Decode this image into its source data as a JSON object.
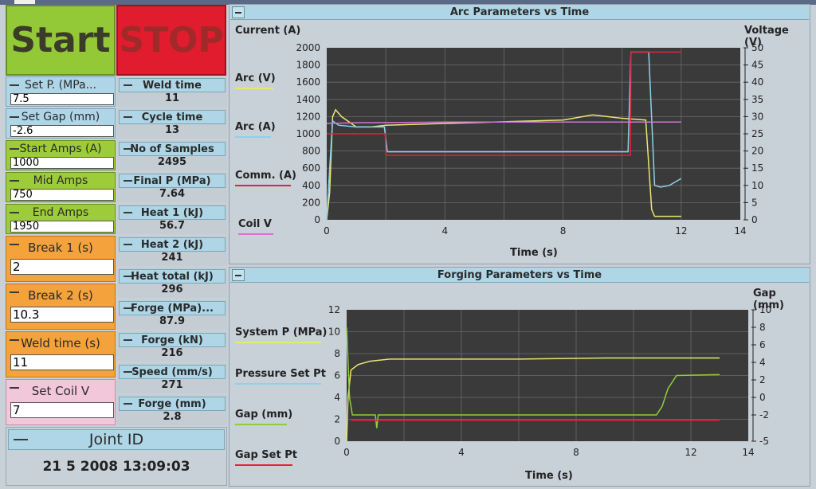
{
  "buttons": {
    "start_label": "Start",
    "stop_label": "STOP"
  },
  "controls": [
    {
      "label": "Set P. (MPa...",
      "value": "7.5",
      "color": "blue"
    },
    {
      "label": "Set Gap (mm)",
      "value": "-2.6",
      "color": "blue"
    },
    {
      "label": "Start Amps (A)",
      "value": "1000",
      "color": "green"
    },
    {
      "label": "Mid Amps",
      "value": "750",
      "color": "green"
    },
    {
      "label": "End Amps",
      "value": "1950",
      "color": "green"
    },
    {
      "label": "Break 1 (s)",
      "value": "2",
      "color": "orange"
    },
    {
      "label": "Break 2 (s)",
      "value": "10.3",
      "color": "orange"
    },
    {
      "label": "Weld time (s)",
      "value": "11",
      "color": "orange"
    },
    {
      "label": "Set Coil V",
      "value": "7",
      "color": "pink"
    }
  ],
  "indicators": [
    {
      "label": "Weld time",
      "value": "11"
    },
    {
      "label": "Cycle time",
      "value": "13"
    },
    {
      "label": "No of Samples",
      "value": "2495"
    },
    {
      "label": "Final P (MPa)",
      "value": "7.64"
    },
    {
      "label": "Heat 1 (kJ)",
      "value": "56.7"
    },
    {
      "label": "Heat 2 (kJ)",
      "value": "241"
    },
    {
      "label": "Heat total (kJ)",
      "value": "296"
    },
    {
      "label": "Forge (MPa)...",
      "value": "87.9"
    },
    {
      "label": "Forge (kN)",
      "value": "216"
    },
    {
      "label": "Speed (mm/s)",
      "value": "271"
    },
    {
      "label": "Forge (mm)",
      "value": "2.8"
    }
  ],
  "joint": {
    "title": "Joint ID",
    "timestamp": "21  5  2008  13:09:03"
  },
  "chart_data": [
    {
      "type": "line",
      "title": "Arc Parameters vs Time",
      "xlabel": "Time (s)",
      "ylabel": "Current (A)",
      "y2label": "Voltage (V)",
      "xlim": [
        0,
        14
      ],
      "ylim": [
        0,
        2000
      ],
      "y2lim": [
        0,
        50
      ],
      "xticks": [
        "0",
        "4",
        "8",
        "12",
        "14"
      ],
      "yticks": [
        "0",
        "200",
        "400",
        "600",
        "800",
        "1000",
        "1200",
        "1400",
        "1600",
        "1800",
        "2000"
      ],
      "y2ticks": [
        "0",
        "5",
        "10",
        "15",
        "20",
        "25",
        "30",
        "35",
        "40",
        "45",
        "50"
      ],
      "series": [
        {
          "name": "Arc (V)",
          "axis": "right",
          "color": "#e8e870",
          "x": [
            0,
            0.1,
            0.2,
            0.3,
            0.5,
            1.0,
            1.5,
            2.0,
            4.0,
            6.0,
            8.0,
            9.0,
            10.0,
            10.8,
            11.0,
            11.1,
            12.0
          ],
          "y": [
            0,
            8,
            30,
            32,
            30,
            27,
            27,
            27.5,
            28,
            28.5,
            29,
            30.5,
            29.5,
            29,
            3,
            1,
            1
          ]
        },
        {
          "name": "Arc (A)",
          "axis": "left",
          "color": "#8fd0e8",
          "x": [
            0,
            0.1,
            0.2,
            0.4,
            1.0,
            1.5,
            1.95,
            2.05,
            4.0,
            6.0,
            8.0,
            10.2,
            10.3,
            10.6,
            10.9,
            11.1,
            11.3,
            11.6,
            12.0
          ],
          "y": [
            0,
            600,
            1150,
            1100,
            1080,
            1080,
            1080,
            790,
            790,
            790,
            790,
            790,
            1950,
            1950,
            1950,
            400,
            380,
            400,
            480
          ]
        },
        {
          "name": "Comm. (A)",
          "axis": "left",
          "color": "#e8203a",
          "x": [
            0,
            0.3,
            1.98,
            2.0,
            10.28,
            10.3,
            12.0
          ],
          "y": [
            1000,
            1000,
            1000,
            750,
            750,
            1950,
            1950
          ]
        },
        {
          "name": "Coil V",
          "axis": "right",
          "color": "#d870d8",
          "x": [
            0,
            1,
            4,
            8,
            10,
            12
          ],
          "y": [
            28,
            28.2,
            28.4,
            28.4,
            28.4,
            28.4
          ]
        }
      ]
    },
    {
      "type": "line",
      "title": "Forging Parameters vs Time",
      "xlabel": "Time (s)",
      "ylabel": "",
      "y2label": "Gap (mm)",
      "xlim": [
        0,
        14
      ],
      "ylim": [
        0,
        12
      ],
      "y2lim": [
        -5,
        10
      ],
      "xticks": [
        "0",
        "4",
        "8",
        "12",
        "14"
      ],
      "yticks": [
        "0",
        "2",
        "4",
        "6",
        "8",
        "10",
        "12"
      ],
      "y2ticks": [
        "-5",
        "-2",
        "0",
        "2",
        "4",
        "6",
        "8",
        "10"
      ],
      "series": [
        {
          "name": "System P (MPa)",
          "axis": "left",
          "color": "#e8e870",
          "x": [
            0,
            0.05,
            0.15,
            0.4,
            0.8,
            1.5,
            3.0,
            6.0,
            9.0,
            11.0,
            13.0
          ],
          "y": [
            0,
            4,
            6.5,
            7.0,
            7.3,
            7.5,
            7.5,
            7.5,
            7.6,
            7.6,
            7.6
          ]
        },
        {
          "name": "Pressure Set Pt",
          "axis": "left",
          "color": "#8fd0e8",
          "x": [],
          "y": []
        },
        {
          "name": "Gap (mm)",
          "axis": "right",
          "color": "#8ccf3a",
          "x": [
            0,
            0.1,
            0.2,
            1.0,
            1.05,
            1.1,
            2.0,
            6.0,
            10.8,
            11.0,
            11.2,
            11.5,
            13.0
          ],
          "y": [
            8,
            0,
            -2,
            -2,
            -3.5,
            -2,
            -2,
            -2,
            -2,
            -1,
            1,
            2.5,
            2.6
          ]
        },
        {
          "name": "Gap Set Pt",
          "axis": "right",
          "color": "#e8203a",
          "x": [
            0.15,
            13.0
          ],
          "y": [
            -2.6,
            -2.6
          ]
        }
      ]
    }
  ]
}
